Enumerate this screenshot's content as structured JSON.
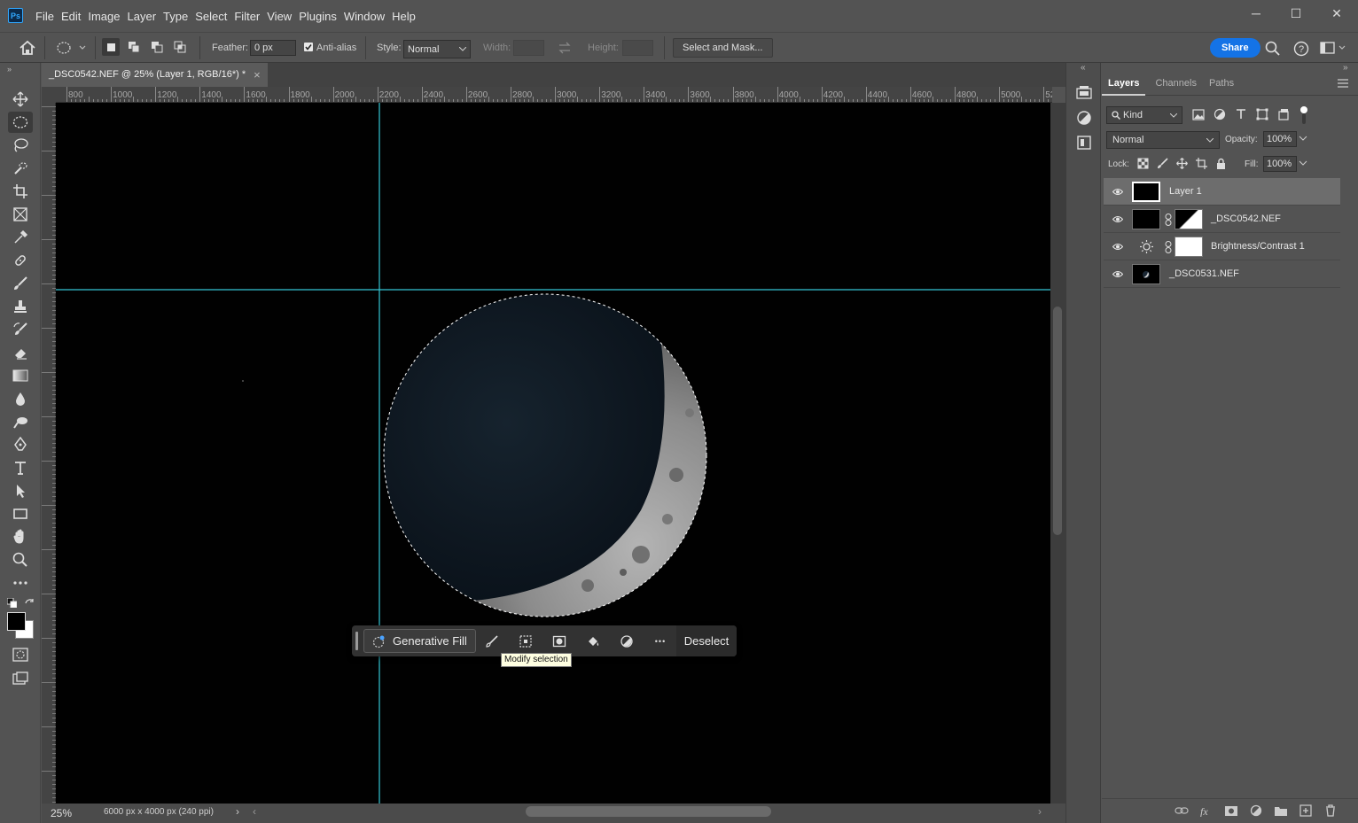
{
  "app": {
    "logo": "Ps",
    "menu": [
      "File",
      "Edit",
      "Image",
      "Layer",
      "Type",
      "Select",
      "Filter",
      "View",
      "Plugins",
      "Window",
      "Help"
    ],
    "window_controls": {
      "minimize": "─",
      "maximize": "☐",
      "close": "✕"
    }
  },
  "options": {
    "feather_label": "Feather:",
    "feather_value": "0 px",
    "antialias_label": "Anti-alias",
    "antialias_checked": true,
    "style_label": "Style:",
    "style_value": "Normal",
    "width_label": "Width:",
    "height_label": "Height:",
    "select_mask_label": "Select and Mask...",
    "share_label": "Share"
  },
  "document": {
    "tab_title": "_DSC0542.NEF @ 25% (Layer 1, RGB/16*) *",
    "close_glyph": "×",
    "zoom": "25%",
    "info": "6000 px x 4000 px (240 ppi)"
  },
  "ruler": {
    "labels": [
      "800",
      "1000",
      "1200",
      "1400",
      "1600",
      "1800",
      "2000",
      "2200",
      "2400",
      "2600",
      "2800",
      "3000",
      "3200",
      "3400",
      "3600",
      "3800",
      "4000",
      "4200",
      "4400",
      "4600",
      "4800",
      "5000",
      "52"
    ]
  },
  "taskbar": {
    "generative_fill_label": "Generative Fill",
    "more_glyph": "•••",
    "deselect_label": "Deselect",
    "tooltip": "Modify selection"
  },
  "layers_panel": {
    "tabs": [
      "Layers",
      "Channels",
      "Paths"
    ],
    "active_tab": "Layers",
    "filter_kind": "Kind",
    "blend_mode": "Normal",
    "opacity_label": "Opacity:",
    "opacity_value": "100%",
    "lock_label": "Lock:",
    "fill_label": "Fill:",
    "fill_value": "100%",
    "layers": [
      {
        "name": "Layer 1",
        "selected": true
      },
      {
        "name": "_DSC0542.NEF",
        "selected": false
      },
      {
        "name": "Brightness/Contrast 1",
        "selected": false
      },
      {
        "name": "_DSC0531.NEF",
        "selected": false
      }
    ]
  },
  "colors": {
    "accent": "#1473e6",
    "guide": "#35c7d6",
    "canvas": "#010101"
  }
}
